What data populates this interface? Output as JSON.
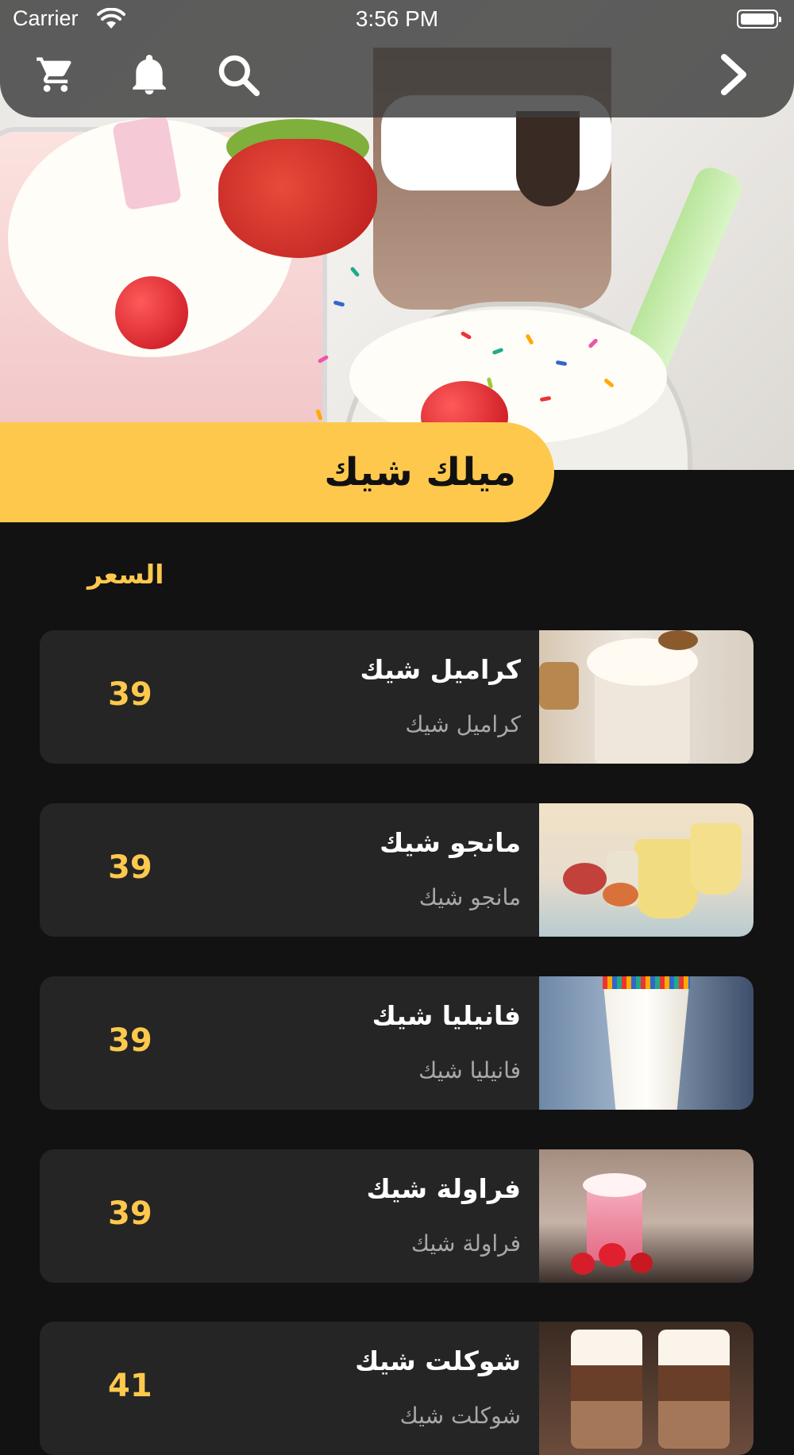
{
  "status_bar": {
    "carrier": "Carrier",
    "time": "3:56 PM"
  },
  "toolbar": {
    "icons": [
      "cart-icon",
      "bell-icon",
      "search-icon",
      "chevron-right-icon"
    ]
  },
  "category": {
    "title": "ميلك شيك"
  },
  "list_header": {
    "price_label": "السعر"
  },
  "products": [
    {
      "name": "كراميل شيك",
      "description": "كراميل شيك",
      "price": "39"
    },
    {
      "name": "مانجو شيك",
      "description": "مانجو شيك",
      "price": "39"
    },
    {
      "name": "فانيليا شيك",
      "description": "فانيليا شيك",
      "price": "39"
    },
    {
      "name": "فراولة شيك",
      "description": "فراولة شيك",
      "price": "39"
    },
    {
      "name": "شوكلت شيك",
      "description": "شوكلت شيك",
      "price": "41"
    }
  ],
  "colors": {
    "accent": "#fec84d",
    "background": "#121212",
    "card": "#252525",
    "top_bar": "#3c3c3c"
  }
}
